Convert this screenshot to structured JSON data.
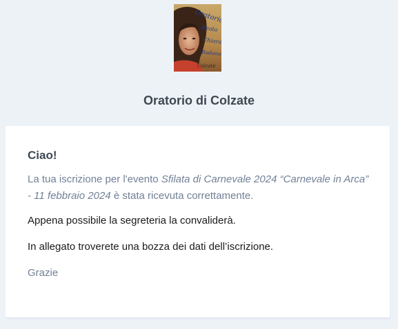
{
  "header": {
    "logo_lines": [
      "Oratorio",
      "Beato",
      "Chiara",
      "Badano",
      "Colzate"
    ],
    "org_name": "Oratorio di Colzate"
  },
  "email": {
    "greeting": "Ciao!",
    "registration": {
      "before": "La tua iscrizione per l'evento ",
      "event": "Sfilata di Carnevale 2024 “Carnevale in Arca” - 11 febbraio 2024",
      "after": " è stata ricevuta correttamente."
    },
    "confirm_line": "Appena possibile la segreteria la convaliderà.",
    "attachment_line": "In allegato troverete una bozza dei dati dell’iscrizione.",
    "closing": "Grazie"
  },
  "colors": {
    "background": "#edf2f7",
    "card": "#ffffff",
    "heading": "#3d4852",
    "muted_text": "#718096",
    "body_text": "#1a1a1a"
  }
}
